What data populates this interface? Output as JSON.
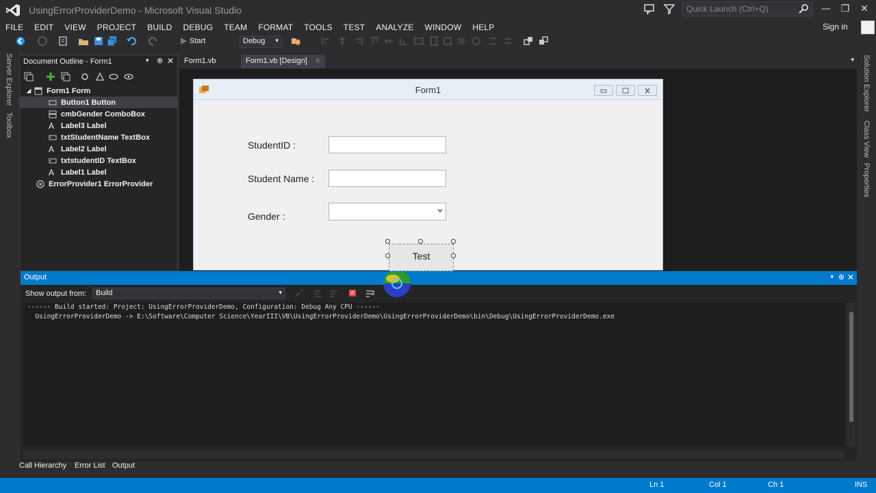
{
  "window": {
    "title": "UsingErrorProviderDemo - Microsoft Visual Studio",
    "quick_launch_placeholder": "Quick Launch (Ctrl+Q)",
    "sign_in": "Sign in"
  },
  "menu": [
    "FILE",
    "EDIT",
    "VIEW",
    "PROJECT",
    "BUILD",
    "DEBUG",
    "TEAM",
    "FORMAT",
    "TOOLS",
    "TEST",
    "ANALYZE",
    "WINDOW",
    "HELP"
  ],
  "toolbar": {
    "start_label": "Start",
    "configuration": "Debug"
  },
  "left_side_tabs": [
    "Server Explorer",
    "Toolbox"
  ],
  "right_side_tabs": [
    "Solution Explorer",
    "Class View",
    "Properties"
  ],
  "document_outline": {
    "header": "Document Outline - Form1",
    "items": [
      {
        "label": "Form1  Form",
        "icon": "form-icon"
      },
      {
        "label": "Button1  Button",
        "icon": "button-icon",
        "selected": true
      },
      {
        "label": "cmbGender  ComboBox",
        "icon": "combobox-icon"
      },
      {
        "label": "Label3  Label",
        "icon": "label-icon"
      },
      {
        "label": "txtStudentName  TextBox",
        "icon": "textbox-icon"
      },
      {
        "label": "Label2  Label",
        "icon": "label-icon"
      },
      {
        "label": "txtstudentID  TextBox",
        "icon": "textbox-icon"
      },
      {
        "label": "Label1  Label",
        "icon": "label-icon"
      },
      {
        "label": "ErrorProvider1  ErrorProvider",
        "icon": "error-provider-icon"
      }
    ]
  },
  "doc_tabs": [
    "Form1.vb",
    "Form1.vb [Design]"
  ],
  "form": {
    "title": "Form1",
    "labels": [
      "StudentID :",
      "Student Name :",
      "Gender :"
    ],
    "button_text": "Test"
  },
  "output": {
    "header": "Output",
    "show_output_from_label": "Show output from:",
    "source": "Build",
    "lines": [
      "------ Build started: Project: UsingErrorProviderDemo, Configuration: Debug Any CPU ------",
      "  UsingErrorProviderDemo -> E:\\Software\\Computer Science\\YearIII\\VB\\UsingErrorProviderDemo\\UsingErrorProviderDemo\\bin\\Debug\\UsingErrorProviderDemo.exe"
    ]
  },
  "bottom_tabs": [
    "Call Hierarchy",
    "Error List",
    "Output"
  ],
  "status": {
    "ln": "Ln 1",
    "col": "Col 1",
    "ch": "Ch 1",
    "mode": "INS"
  },
  "colors": {
    "accent": "#007acc",
    "background": "#2d2d30",
    "panel": "#252526",
    "editor": "#1e1e1e"
  }
}
